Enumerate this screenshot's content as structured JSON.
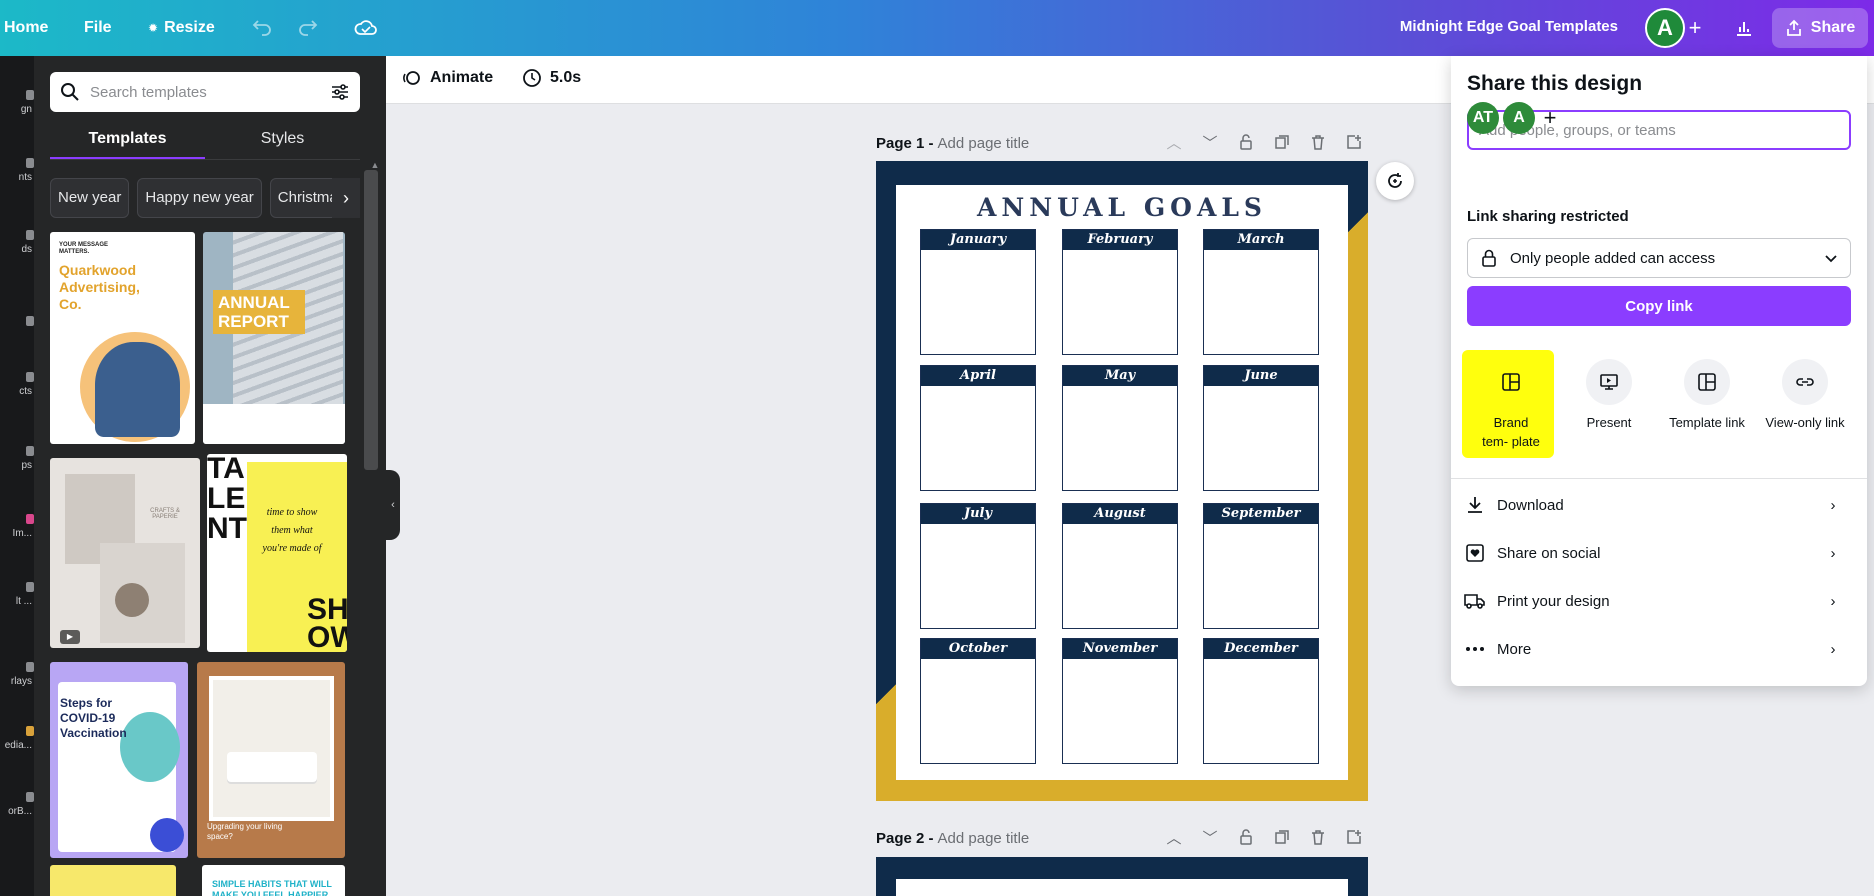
{
  "topbar": {
    "home_label": "Home",
    "file_label": "File",
    "resize_label": "Resize",
    "doc_title": "Midnight Edge Goal Templates",
    "avatar_initial": "A",
    "share_label": "Share",
    "icons": [
      "undo-icon",
      "redo-icon",
      "cloud-save-icon",
      "plus-icon",
      "analytics-icon",
      "share-icon"
    ]
  },
  "rail": {
    "items": [
      {
        "label": "gn"
      },
      {
        "label": "nts"
      },
      {
        "label": "ds"
      },
      {
        "label": ""
      },
      {
        "label": "cts"
      },
      {
        "label": "ps"
      },
      {
        "label": "Im..."
      },
      {
        "label": "lt ..."
      },
      {
        "label": "rlays"
      },
      {
        "label": "edia..."
      },
      {
        "label": "orB..."
      }
    ]
  },
  "panel": {
    "search_placeholder": "Search templates",
    "tabs": [
      {
        "label": "Templates",
        "active": true
      },
      {
        "label": "Styles",
        "active": false
      }
    ],
    "chips": [
      "New year",
      "Happy new year",
      "Christmas"
    ],
    "templates": {
      "t1_small": "YOUR MESSAGE MATTERS.",
      "t1_title": "Quarkwood Advertising, Co.",
      "t2_title": "ANNUAL REPORT",
      "t3_brand": "CRAFTS & PAPERIE",
      "t4_big": "TA LE NT",
      "t4_mid": "time to show them what you're made of",
      "t4_show": "SH OW",
      "t5_title": "Steps for COVID-19 Vaccination",
      "t6_text": "Upgrading your living space?",
      "t8_text": "SIMPLE HABITS THAT WILL MAKE YOU FEEL HAPPIER"
    }
  },
  "canvas_toolbar": {
    "animate_label": "Animate",
    "duration_label": "5.0s"
  },
  "pages": [
    {
      "label": "Page 1 -",
      "placeholder": "Add page title"
    },
    {
      "label": "Page 2 -",
      "placeholder": "Add page title"
    }
  ],
  "design": {
    "title": "ANNUAL GOALS",
    "months": [
      "January",
      "February",
      "March",
      "April",
      "May",
      "June",
      "July",
      "August",
      "September",
      "October",
      "November",
      "December"
    ],
    "colors": {
      "navy": "#0f2b4a",
      "gold": "#d9ad2b"
    }
  },
  "share_popover": {
    "title": "Share this design",
    "input_placeholder": "Add people, groups, or teams",
    "avatars": [
      "AT",
      "A"
    ],
    "link_heading": "Link sharing restricted",
    "access_value": "Only people added can access",
    "copy_label": "Copy link",
    "options": [
      {
        "label": "Brand tem- plate",
        "icon": "brand-template-icon",
        "highlighted": true
      },
      {
        "label": "Present",
        "icon": "present-icon",
        "highlighted": false
      },
      {
        "label": "Template link",
        "icon": "template-link-icon",
        "highlighted": false
      },
      {
        "label": "View-only link",
        "icon": "view-only-link-icon",
        "highlighted": false
      }
    ],
    "rows": [
      {
        "label": "Download",
        "icon": "download-icon"
      },
      {
        "label": "Share on social",
        "icon": "heart-social-icon"
      },
      {
        "label": "Print your design",
        "icon": "truck-print-icon"
      },
      {
        "label": "More",
        "icon": "more-dots-icon"
      }
    ]
  },
  "colors": {
    "accent": "#8b3dff",
    "highlight": "#ffff00"
  }
}
